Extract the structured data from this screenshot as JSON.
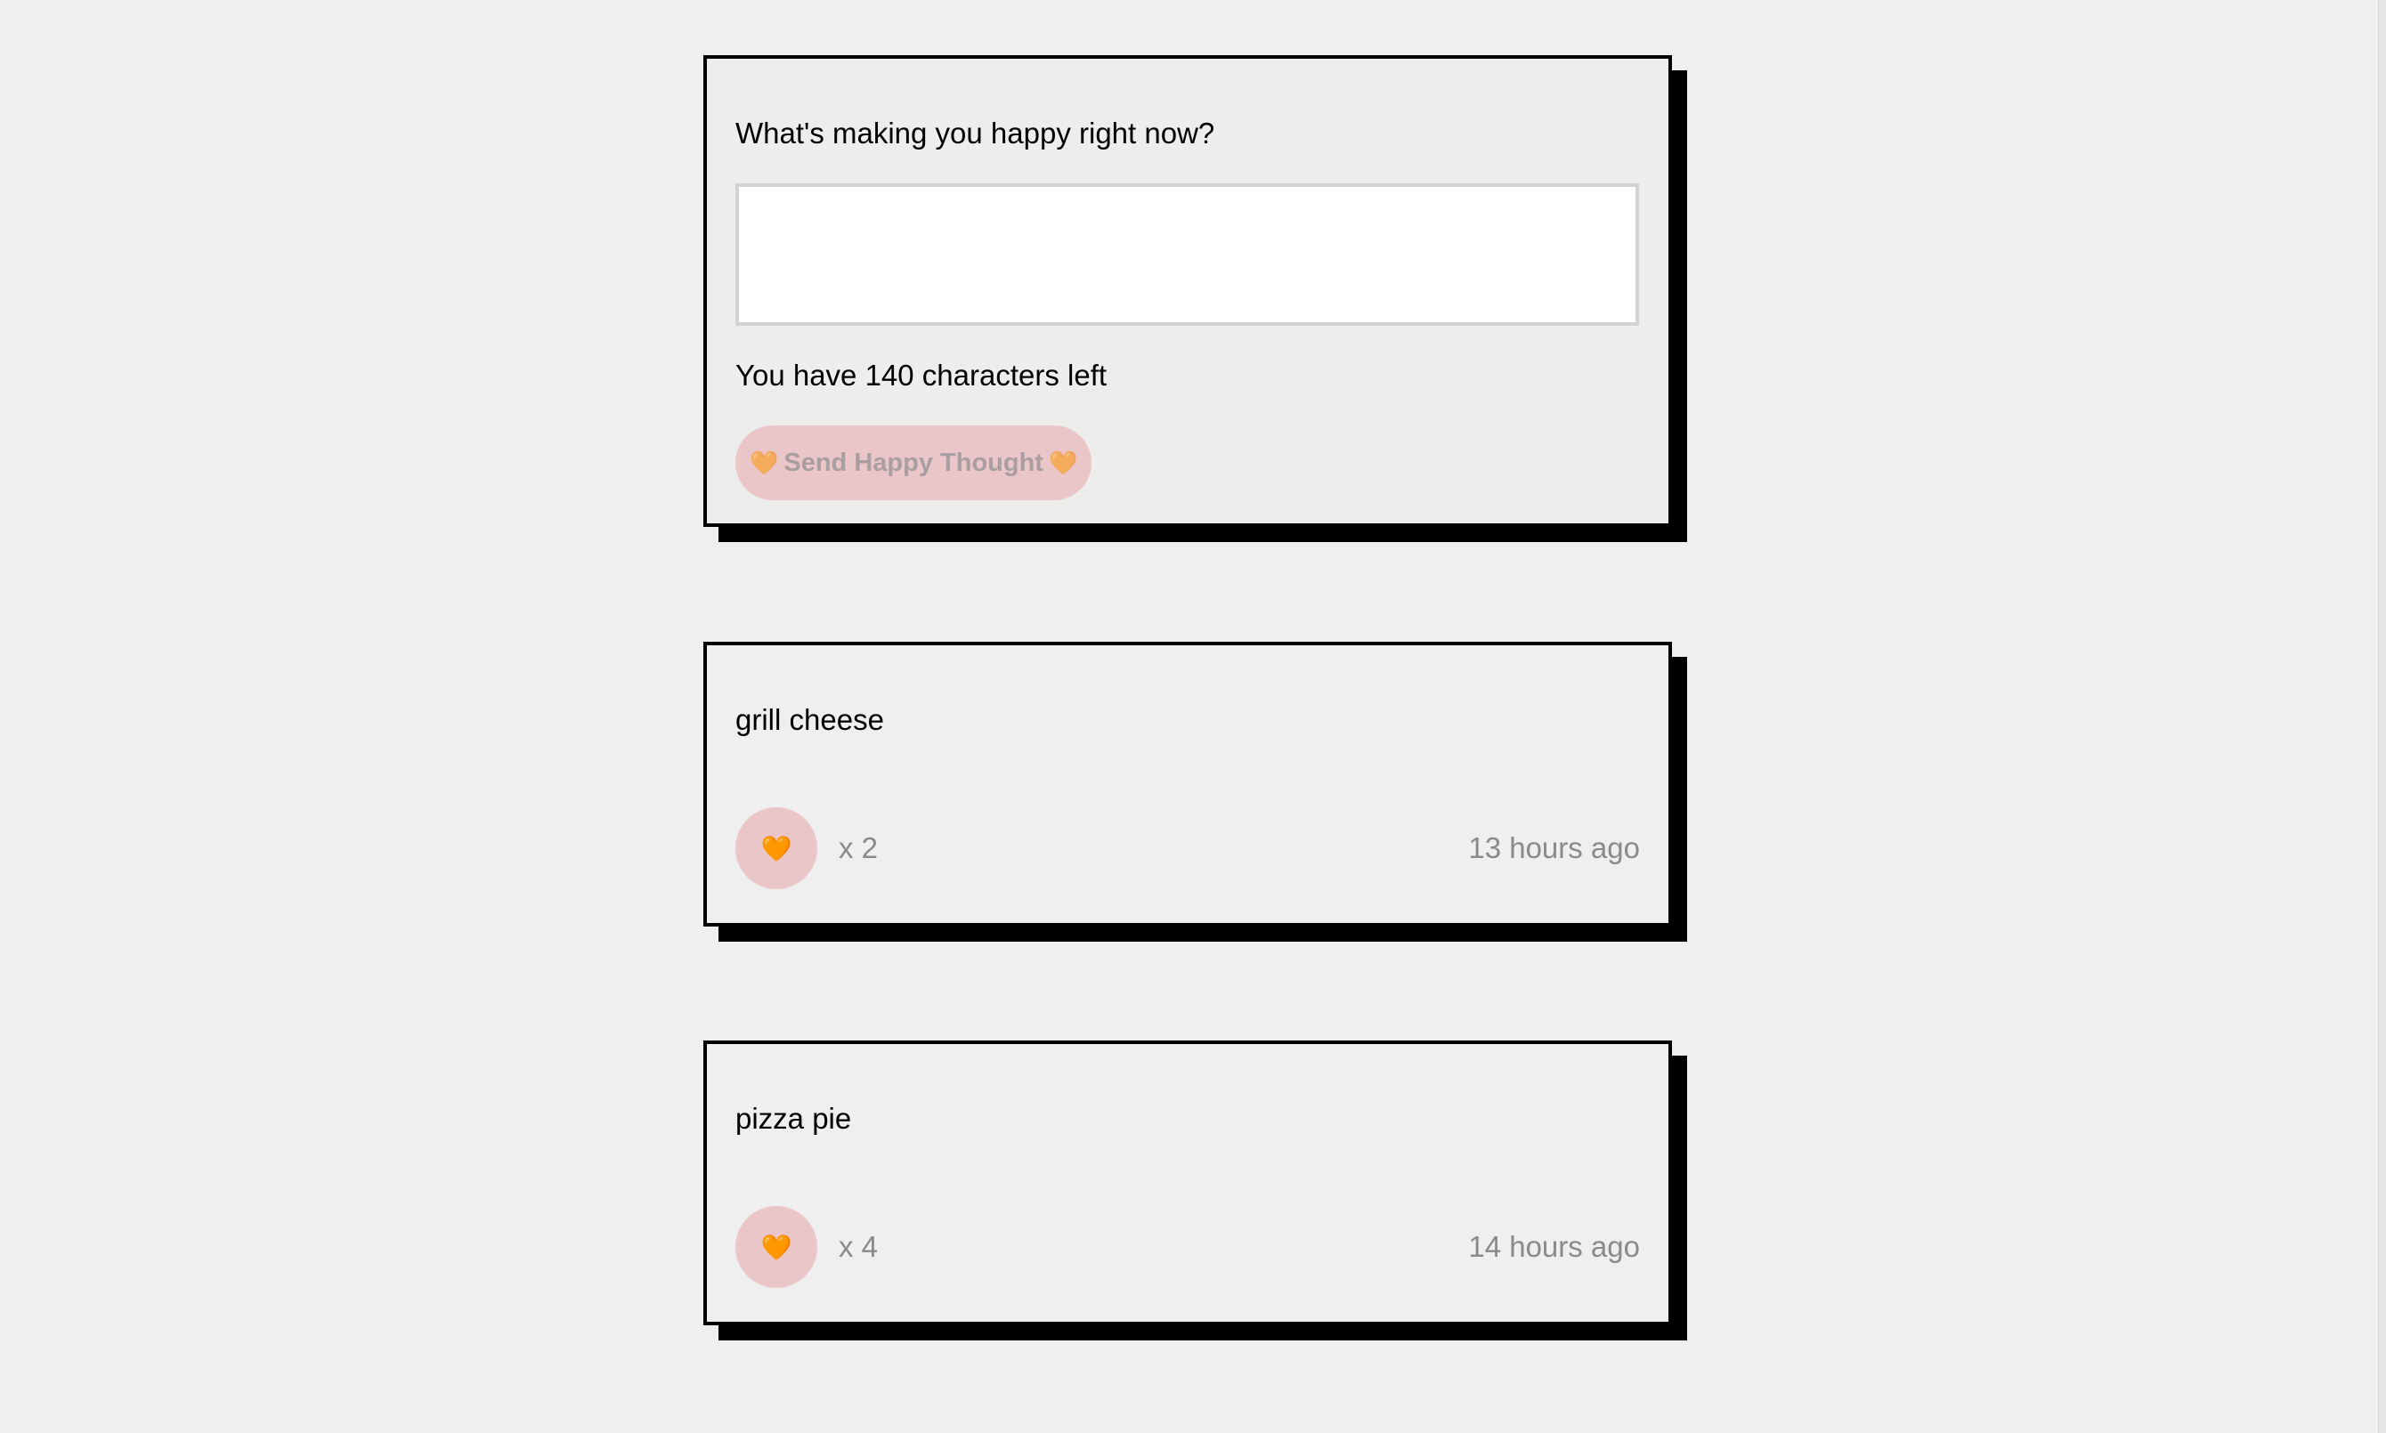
{
  "form": {
    "prompt": "What's making you happy right now?",
    "input_value": "",
    "char_count_text": "You have 140 characters left",
    "send_button_label": "Send Happy Thought",
    "send_button_icon": "heart-icon"
  },
  "thoughts": [
    {
      "message": "grill cheese",
      "likes_text": "x 2",
      "time_text": "13 hours ago",
      "like_icon": "heart-icon"
    },
    {
      "message": "pizza pie",
      "likes_text": "x 4",
      "time_text": "14 hours ago",
      "like_icon": "heart-icon"
    }
  ],
  "colors": {
    "background": "#efefef",
    "accent_pink": "#eac6c9",
    "shadow": "#000000",
    "muted_text": "#8a8a8a"
  }
}
